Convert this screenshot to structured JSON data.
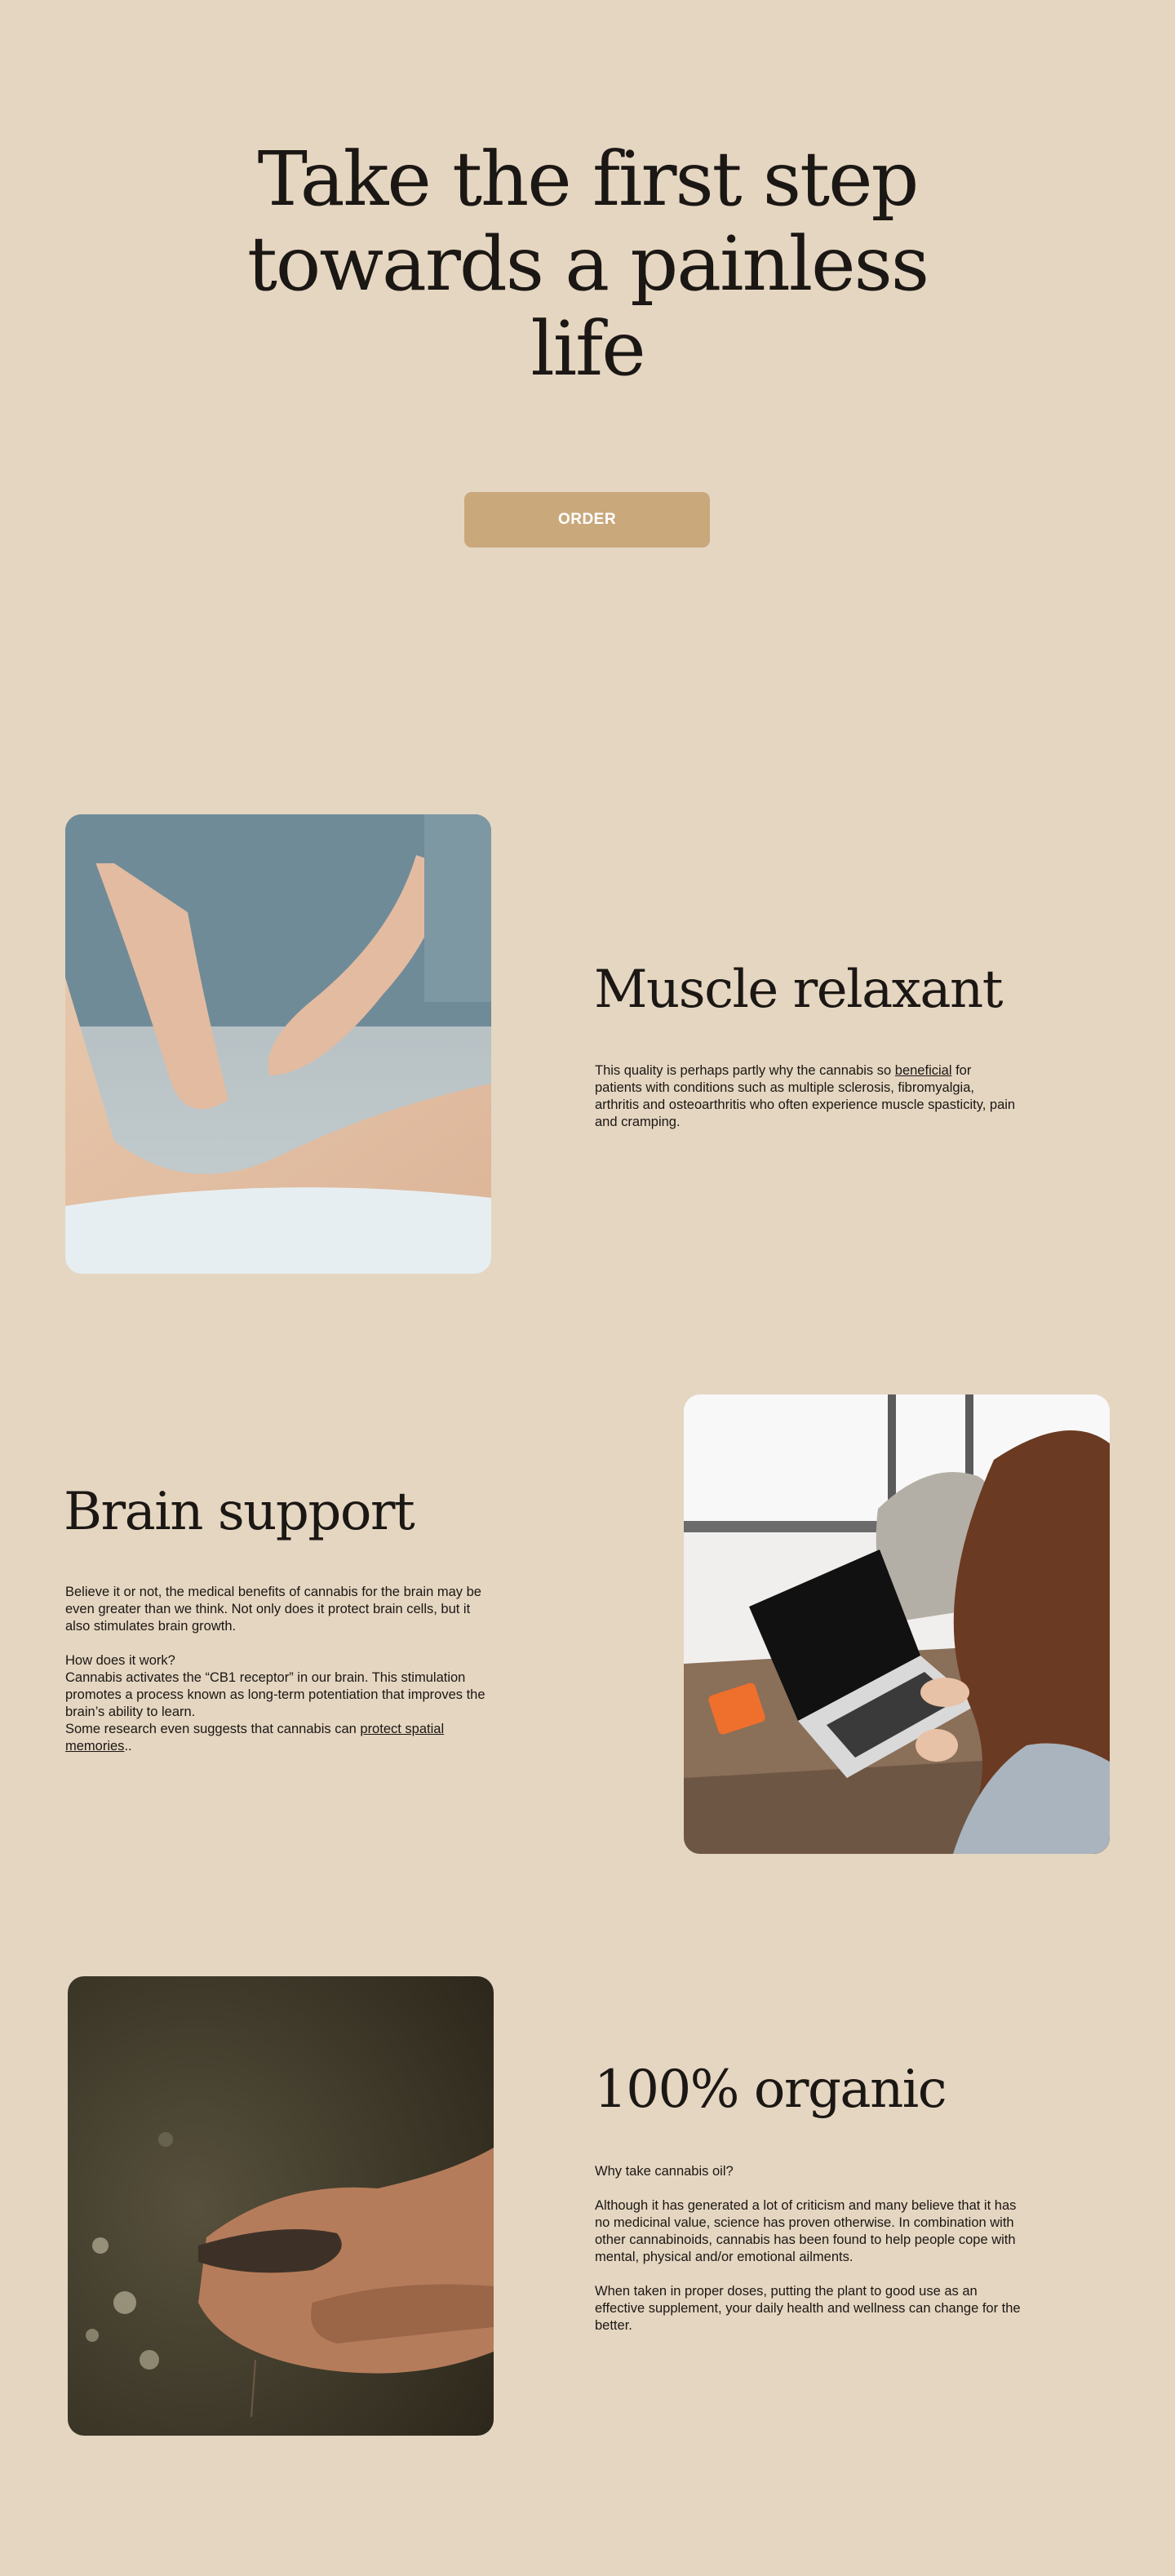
{
  "hero": {
    "title_line1": "Take the first step",
    "title_line2": "towards a painless",
    "title_line3": "life",
    "order_label": "ORDER"
  },
  "sections": [
    {
      "heading": "Muscle relaxant",
      "image_icon": "massage-photo",
      "text_before_link": "This quality is perhaps partly why the cannabis so ",
      "link": "beneficial",
      "text_after_link": " for patients with conditions such as multiple sclerosis, fibromyalgia, arthritis and osteoarthritis who often experience muscle spasticity, pain and cramping."
    },
    {
      "heading": "Brain support",
      "image_icon": "laptop-woman-photo",
      "paragraph1": "Believe it or not, the medical benefits of cannabis for the brain may be even greater than we think. Not only does it protect brain cells, but it also stimulates brain growth.",
      "question": "How does it work?",
      "paragraph2": "Cannabis activates the “CB1 receptor” in our brain. This stimulation promotes a process known as long-term potentiation that improves the brain’s ability to learn.",
      "text_before_link": "Some research even suggests that cannabis can ",
      "link": "protect spatial memories",
      "text_after_link": ".."
    },
    {
      "heading": "100% organic",
      "image_icon": "hands-soil-photo",
      "question": "Why take cannabis oil?",
      "paragraph1": "Although it has generated a lot of criticism and many believe that it has no medicinal value, science has proven otherwise. In combination with other cannabinoids, cannabis has been found to help people cope with mental, physical and/or emotional ailments.",
      "paragraph2": "When taken in proper doses, putting the plant to good use as an effective supplement, your daily health and wellness can change for the better."
    }
  ]
}
